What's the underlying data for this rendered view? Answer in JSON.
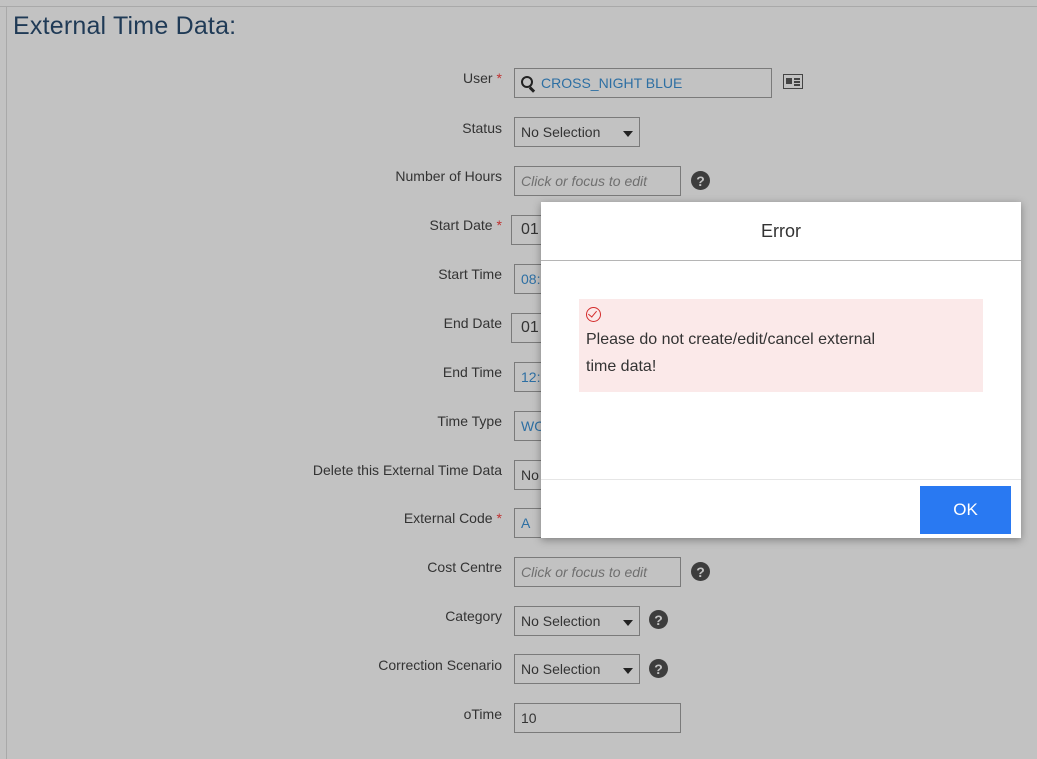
{
  "page": {
    "title": "External Time Data:"
  },
  "required_marker": "*",
  "fields": {
    "user": {
      "label": "User",
      "value": "CROSS_NIGHT BLUE"
    },
    "status": {
      "label": "Status",
      "value": "No Selection"
    },
    "hours": {
      "label": "Number of Hours",
      "placeholder": "Click or focus to edit"
    },
    "start_date": {
      "label": "Start Date",
      "value": "01"
    },
    "start_time": {
      "label": "Start Time",
      "value": "08:"
    },
    "end_date": {
      "label": "End Date",
      "value": "01"
    },
    "end_time": {
      "label": "End Time",
      "value": "12:"
    },
    "time_type": {
      "label": "Time Type",
      "value": "WO"
    },
    "delete": {
      "label": "Delete this External Time Data",
      "value": "No"
    },
    "ext_code": {
      "label": "External Code",
      "value": "A"
    },
    "cost_centre": {
      "label": "Cost Centre",
      "placeholder": "Click or focus to edit"
    },
    "category": {
      "label": "Category",
      "value": "No Selection"
    },
    "correction": {
      "label": "Correction Scenario",
      "value": "No Selection"
    },
    "otime": {
      "label": "oTime",
      "value": "10"
    }
  },
  "help_glyph": "?",
  "dialog": {
    "title": "Error",
    "message": "Please do not create/edit/cancel external time data!",
    "ok_label": "OK"
  },
  "colors": {
    "accent": "#2979f2",
    "error": "#d42c2c",
    "title": "#1f3a56",
    "background": "#c2c2c2"
  }
}
